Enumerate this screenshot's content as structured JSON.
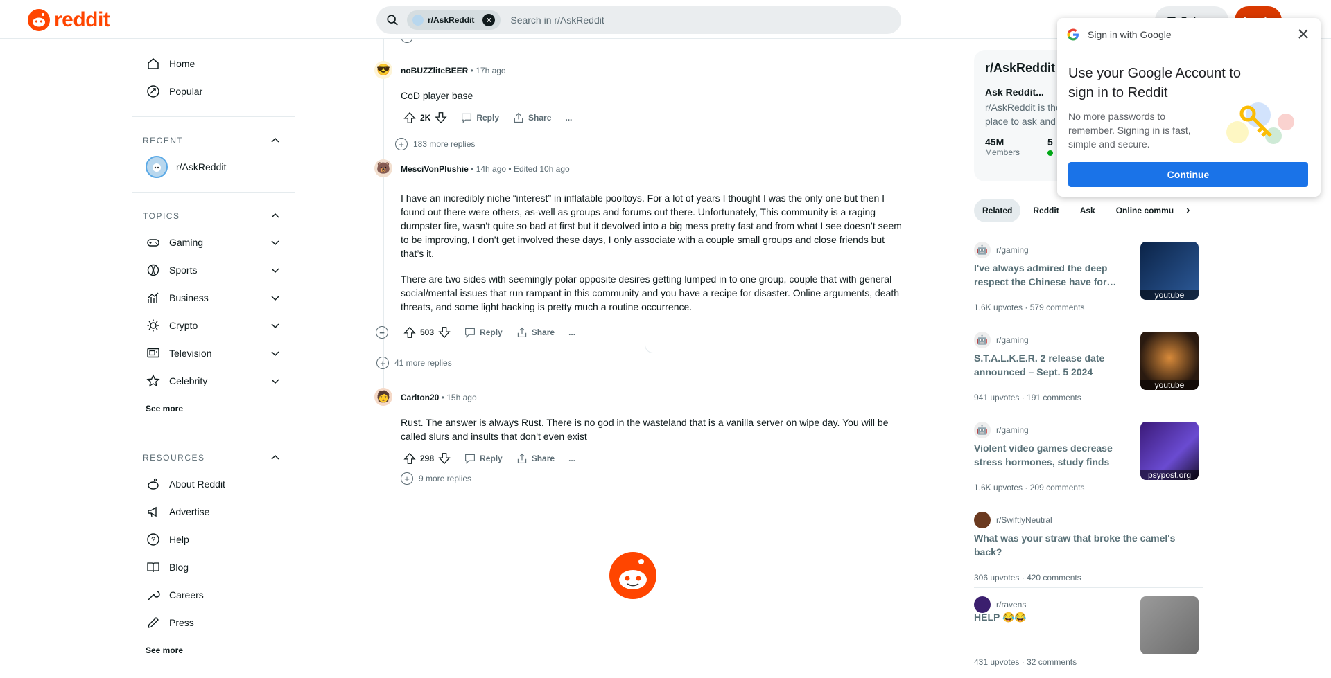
{
  "header": {
    "logo_text": "reddit",
    "search_chip": "r/AskReddit",
    "search_placeholder": "Search in r/AskReddit",
    "get_app": "Get app",
    "login": "Log In"
  },
  "sidebar": {
    "nav": [
      {
        "label": "Home",
        "icon": "home-icon"
      },
      {
        "label": "Popular",
        "icon": "popular-icon"
      }
    ],
    "recent_header": "RECENT",
    "recent": [
      {
        "label": "r/AskReddit"
      }
    ],
    "topics_header": "TOPICS",
    "topics": [
      {
        "label": "Gaming",
        "icon": "gamepad-icon"
      },
      {
        "label": "Sports",
        "icon": "ball-icon"
      },
      {
        "label": "Business",
        "icon": "chart-icon"
      },
      {
        "label": "Crypto",
        "icon": "sun-icon"
      },
      {
        "label": "Television",
        "icon": "tv-icon"
      },
      {
        "label": "Celebrity",
        "icon": "star-icon"
      }
    ],
    "see_more_topics": "See more",
    "resources_header": "RESOURCES",
    "resources": [
      {
        "label": "About Reddit",
        "icon": "reddit-icon"
      },
      {
        "label": "Advertise",
        "icon": "megaphone-icon"
      },
      {
        "label": "Help",
        "icon": "help-icon"
      },
      {
        "label": "Blog",
        "icon": "book-icon"
      },
      {
        "label": "Careers",
        "icon": "wrench-icon"
      },
      {
        "label": "Press",
        "icon": "pen-icon"
      }
    ],
    "see_more_resources": "See more"
  },
  "comments": [
    {
      "author": "noBUZZliteBEER",
      "time": "17h ago",
      "edited": "",
      "body": [
        "CoD player base"
      ],
      "votes": "2K",
      "more_replies": "183 more replies"
    },
    {
      "author": "MesciVonPlushie",
      "time": "14h ago",
      "edited": "Edited 10h ago",
      "body": [
        "I have an incredibly niche “interest” in inflatable pooltoys. For a lot of years I thought I was the only one but then I found out there were others, as-well as groups and forums out there. Unfortunately, This community is a raging dumpster fire, wasn’t quite so bad at first but it devolved into a big mess pretty fast and from what I see doesn’t seem to be improving, I don’t get involved these days, I only associate with a couple small groups and close friends but that’s it.",
        "There are two sides with seemingly polar opposite desires getting lumped in to one group, couple that with general social/mental issues that run rampant in this community and you have a recipe for disaster. Online arguments, death threats, and some light hacking is pretty much a routine occurrence."
      ],
      "votes": "503",
      "more_replies": "41 more replies"
    },
    {
      "author": "Carlton20",
      "time": "15h ago",
      "edited": "",
      "body": [
        "Rust. The answer is always Rust. There is no god in the wasteland that is a vanilla server on wipe day. You will be called slurs and insults that don't even exist"
      ],
      "votes": "298",
      "more_replies": "9 more replies"
    }
  ],
  "actions": {
    "reply": "Reply",
    "share": "Share",
    "more": "..."
  },
  "about": {
    "title": "r/AskReddit",
    "subtitle": "Ask Reddit...",
    "desc": "r/AskReddit is the place to ask and answer thought-provoking",
    "members_value": "45M",
    "members_label": "Members",
    "online_value": "5"
  },
  "pills": [
    "Related",
    "Reddit",
    "Ask",
    "Online commu"
  ],
  "related": [
    {
      "sub": "r/gaming",
      "title": "I've always admired the deep respect the Chinese have for…",
      "upvotes": "1.6K upvotes",
      "comments": "579 comments",
      "thumb_caption": "youtube",
      "thumb_color": "#1c3a66"
    },
    {
      "sub": "r/gaming",
      "title": "S.T.A.L.K.E.R. 2 release date announced – Sept. 5 2024",
      "upvotes": "941 upvotes",
      "comments": "191 comments",
      "thumb_caption": "youtube",
      "thumb_color": "#3a2a1c"
    },
    {
      "sub": "r/gaming",
      "title": "Violent video games decrease stress hormones, study finds",
      "upvotes": "1.6K upvotes",
      "comments": "209 comments",
      "thumb_caption": "psypost.org",
      "thumb_color": "#3a2a6e"
    },
    {
      "sub": "r/SwiftlyNeutral",
      "title": "What was your straw that broke the camel's back?",
      "upvotes": "306 upvotes",
      "comments": "420 comments",
      "thumb_caption": "",
      "thumb_color": ""
    },
    {
      "sub": "r/ravens",
      "title": "HELP 😂😂",
      "upvotes": "431 upvotes",
      "comments": "32 comments",
      "thumb_caption": "",
      "thumb_color": "#8d8d8d"
    }
  ],
  "google": {
    "header": "Sign in with Google",
    "title": "Use your Google Account to sign in to Reddit",
    "desc": "No more passwords to remember. Signing in is fast, simple and secure.",
    "button": "Continue"
  },
  "colors": {
    "reddit_orange": "#ff4500",
    "login": "#d93900",
    "google_blue": "#1a73e8"
  }
}
